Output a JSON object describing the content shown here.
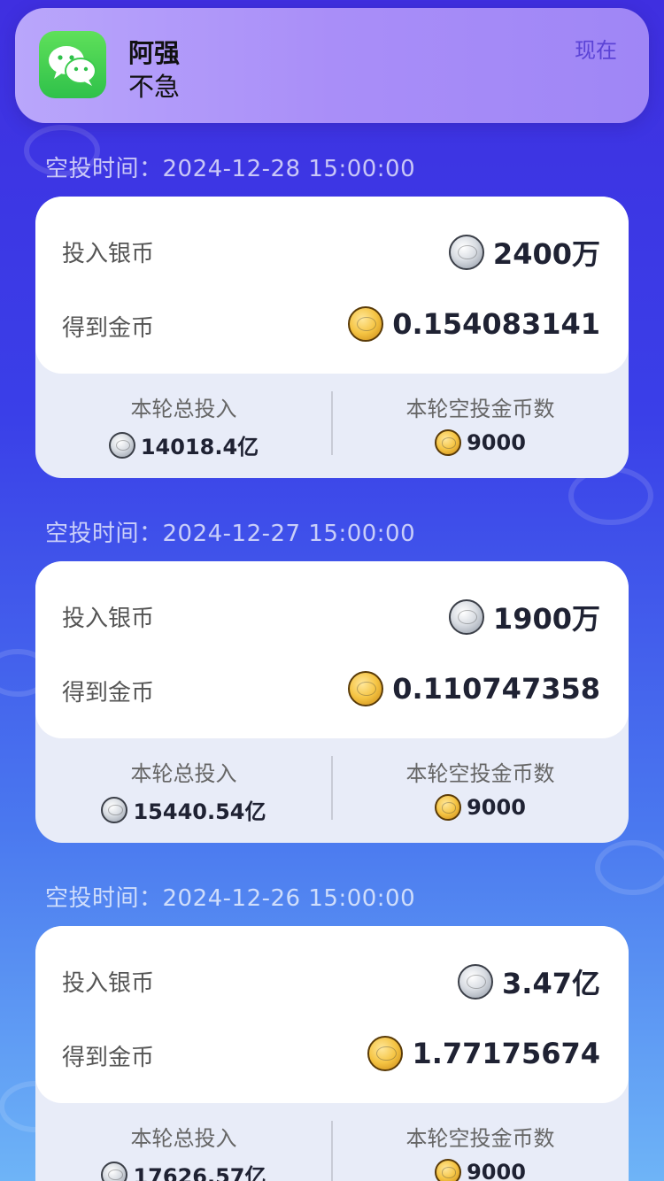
{
  "notification": {
    "app_icon": "wechat-icon",
    "sender": "阿强",
    "message": "不急",
    "time": "现在"
  },
  "records": [
    {
      "airdrop_time_label": "空投时间：2024-12-28 15:00:00",
      "invest_label": "投入银币",
      "invest_value": "2400万",
      "receive_label": "得到金币",
      "receive_value": "0.154083141",
      "round_total_label": "本轮总投入",
      "round_total_value": "14018.4亿",
      "round_airdrop_label": "本轮空投金币数",
      "round_airdrop_value": "9000"
    },
    {
      "airdrop_time_label": "空投时间：2024-12-27 15:00:00",
      "invest_label": "投入银币",
      "invest_value": "1900万",
      "receive_label": "得到金币",
      "receive_value": "0.110747358",
      "round_total_label": "本轮总投入",
      "round_total_value": "15440.54亿",
      "round_airdrop_label": "本轮空投金币数",
      "round_airdrop_value": "9000"
    },
    {
      "airdrop_time_label": "空投时间：2024-12-26 15:00:00",
      "invest_label": "投入银币",
      "invest_value": "3.47亿",
      "receive_label": "得到金币",
      "receive_value": "1.77175674",
      "round_total_label": "本轮总投入",
      "round_total_value": "17626.57亿",
      "round_airdrop_label": "本轮空投金币数",
      "round_airdrop_value": "9000"
    }
  ],
  "icons": {
    "silver": "silver-coin-icon",
    "gold": "gold-coin-icon"
  },
  "colors": {
    "background_top": "#3f2fe0",
    "background_bottom": "#6eb4f7",
    "notification_bg": "#a98ef8",
    "wechat_green": "#2fc14a"
  }
}
